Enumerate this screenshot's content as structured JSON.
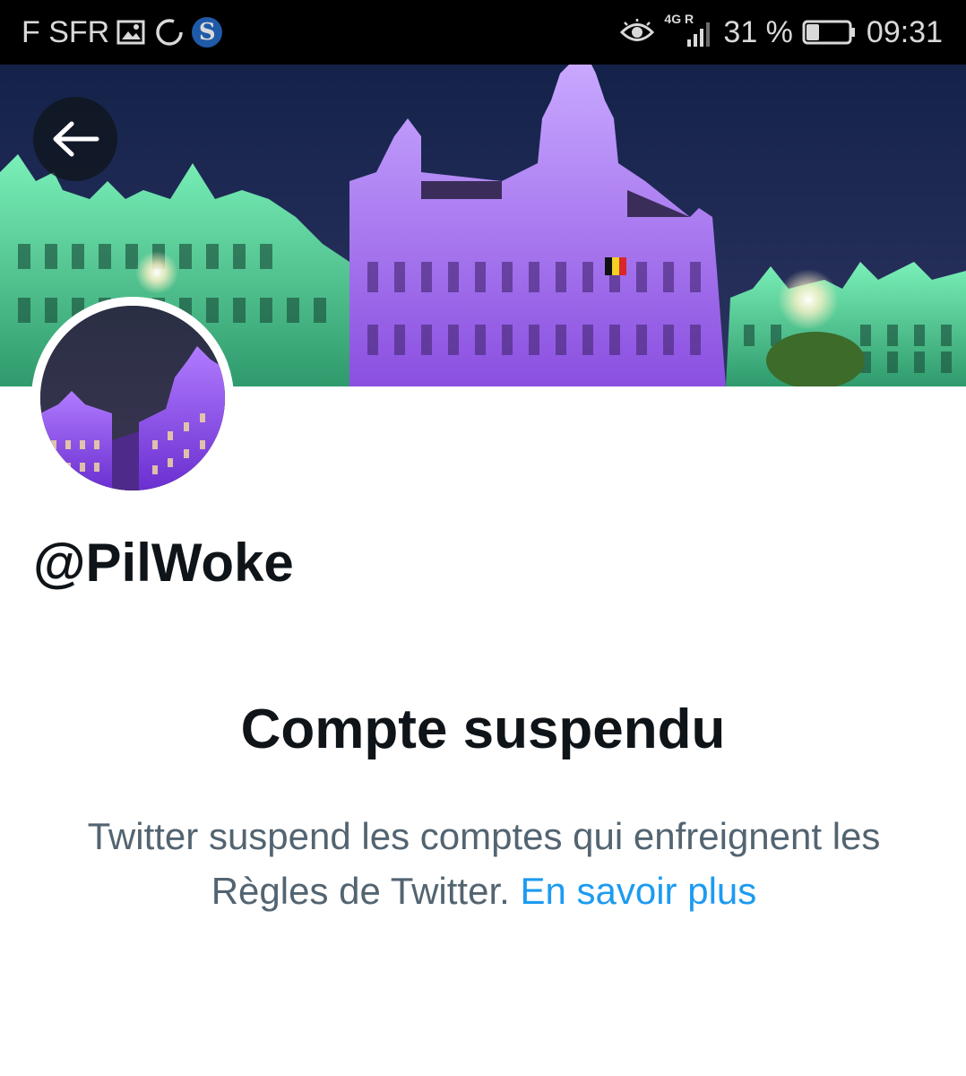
{
  "status_bar": {
    "carrier": "F SFR",
    "s_badge": "S",
    "network": "4G R",
    "battery_percent": "31 %",
    "time": "09:31",
    "battery_level": 0.31
  },
  "profile": {
    "handle": "@PilWoke"
  },
  "suspension": {
    "title": "Compte suspendu",
    "message": "Twitter suspend les comptes qui enfreignent les Règles de Twitter.",
    "link_label": "En savoir plus"
  },
  "colors": {
    "link": "#1d9bf0",
    "text_primary": "#0f1419",
    "text_secondary": "#536471"
  }
}
